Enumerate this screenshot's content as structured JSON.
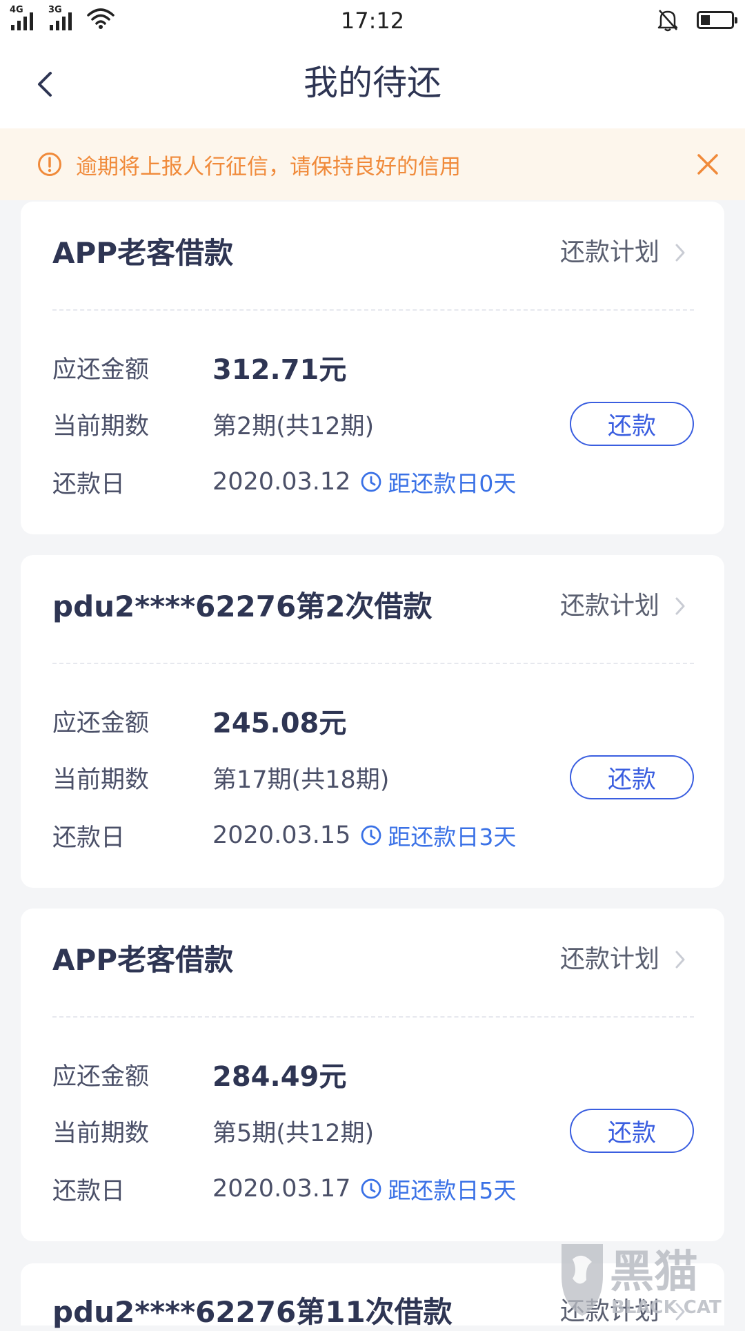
{
  "status_bar": {
    "time": "17:12",
    "sim1": "4G",
    "sim2": "3G",
    "battery_level": 0.3,
    "icons": [
      "signal-icon",
      "wifi-icon",
      "bell-muted-icon",
      "battery-icon"
    ]
  },
  "header": {
    "title": "我的待还"
  },
  "notice": {
    "text": "逾期将上报人行征信，请保持良好的信用",
    "icon": "warning-circle-icon",
    "color": "#f08a3a",
    "background": "#fdf6ec"
  },
  "labels": {
    "plan": "还款计划",
    "amount": "应还金额",
    "period": "当前期数",
    "due_date": "还款日",
    "pay": "还款"
  },
  "loans": [
    {
      "title": "APP老客借款",
      "amount": "312.71元",
      "period": "第2期(共12期)",
      "due_date": "2020.03.12",
      "countdown": "距还款日0天"
    },
    {
      "title": "pdu2****62276第2次借款",
      "amount": "245.08元",
      "period": "第17期(共18期)",
      "due_date": "2020.03.15",
      "countdown": "距还款日3天"
    },
    {
      "title": "APP老客借款",
      "amount": "284.49元",
      "period": "第5期(共12期)",
      "due_date": "2020.03.17",
      "countdown": "距还款日5天"
    },
    {
      "title": "pdu2****62276第11次借款",
      "plan": "还款计划"
    }
  ],
  "watermark": {
    "cn": "黑猫",
    "en": "BLACK CAT"
  },
  "colors": {
    "accent": "#3a5ee0",
    "countdown": "#3a71e6",
    "title": "#2e3553",
    "page_bg": "#f4f5f7"
  }
}
